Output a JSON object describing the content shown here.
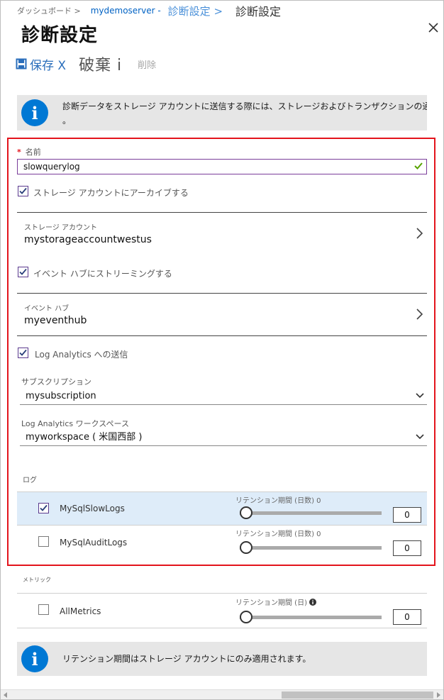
{
  "breadcrumb": [
    "ダッシュボード >",
    "mydemoserver -",
    "診断設定 >",
    "診断設定"
  ],
  "title": "診断設定",
  "toolbar": {
    "save_label": "保存 X",
    "discard_label": "破棄 i",
    "delete_label": "削除"
  },
  "top_banner": {
    "line1": "診断データをストレージ アカウントに送信する際には、ストレージおよびトランザクションの通常のデータ料",
    "line2": "。"
  },
  "name_field": {
    "label": "名前",
    "required_mark": "*",
    "value": "slowquerylog"
  },
  "storage": {
    "checkbox_label": "ストレージ アカウントにアーカイブする",
    "checked": true,
    "account_label": "ストレージ アカウント",
    "account_value": "mystorageaccountwestus"
  },
  "event_hub": {
    "checkbox_label": "イベント ハブにストリーミングする",
    "checked": true,
    "hub_label": "イベント ハブ",
    "hub_value": "myeventhub"
  },
  "log_analytics": {
    "checkbox_label": "Log Analytics への送信",
    "checked": true,
    "subscription_label": "サブスクリプション",
    "subscription_value": "mysubscription",
    "workspace_label": "Log Analytics ワークスペース",
    "workspace_value": "myworkspace ( 米国西部 )"
  },
  "logs": {
    "section_label": "ログ",
    "items": [
      {
        "name": "MySqlSlowLogs",
        "checked": true,
        "retention_label": "リテンション期間 (日数) 0",
        "retention_value": "0",
        "retention_days": 0
      },
      {
        "name": "MySqlAuditLogs",
        "checked": false,
        "retention_label": "リテンション期間 (日数) 0",
        "retention_value": "0",
        "retention_days": 0
      }
    ]
  },
  "metrics": {
    "section_label": "メトリック",
    "items": [
      {
        "name": "AllMetrics",
        "checked": false,
        "retention_label": "リテンション期間 (日)",
        "retention_value": "0",
        "retention_days": 0
      }
    ]
  },
  "bottom_banner": {
    "text": "リテンション期間はストレージ アカウントにのみ適用されます。"
  },
  "icons": [
    "close-icon",
    "save-icon",
    "info-icon",
    "checkmark-icon",
    "chevron-right-icon",
    "chevron-down-icon",
    "info-small-icon"
  ],
  "colors": {
    "accent": "#0078d4",
    "highlight_border": "#e3141c",
    "selected_row": "#deecf9",
    "checkbox": "#5b3a8e",
    "valid": "#57a300"
  }
}
